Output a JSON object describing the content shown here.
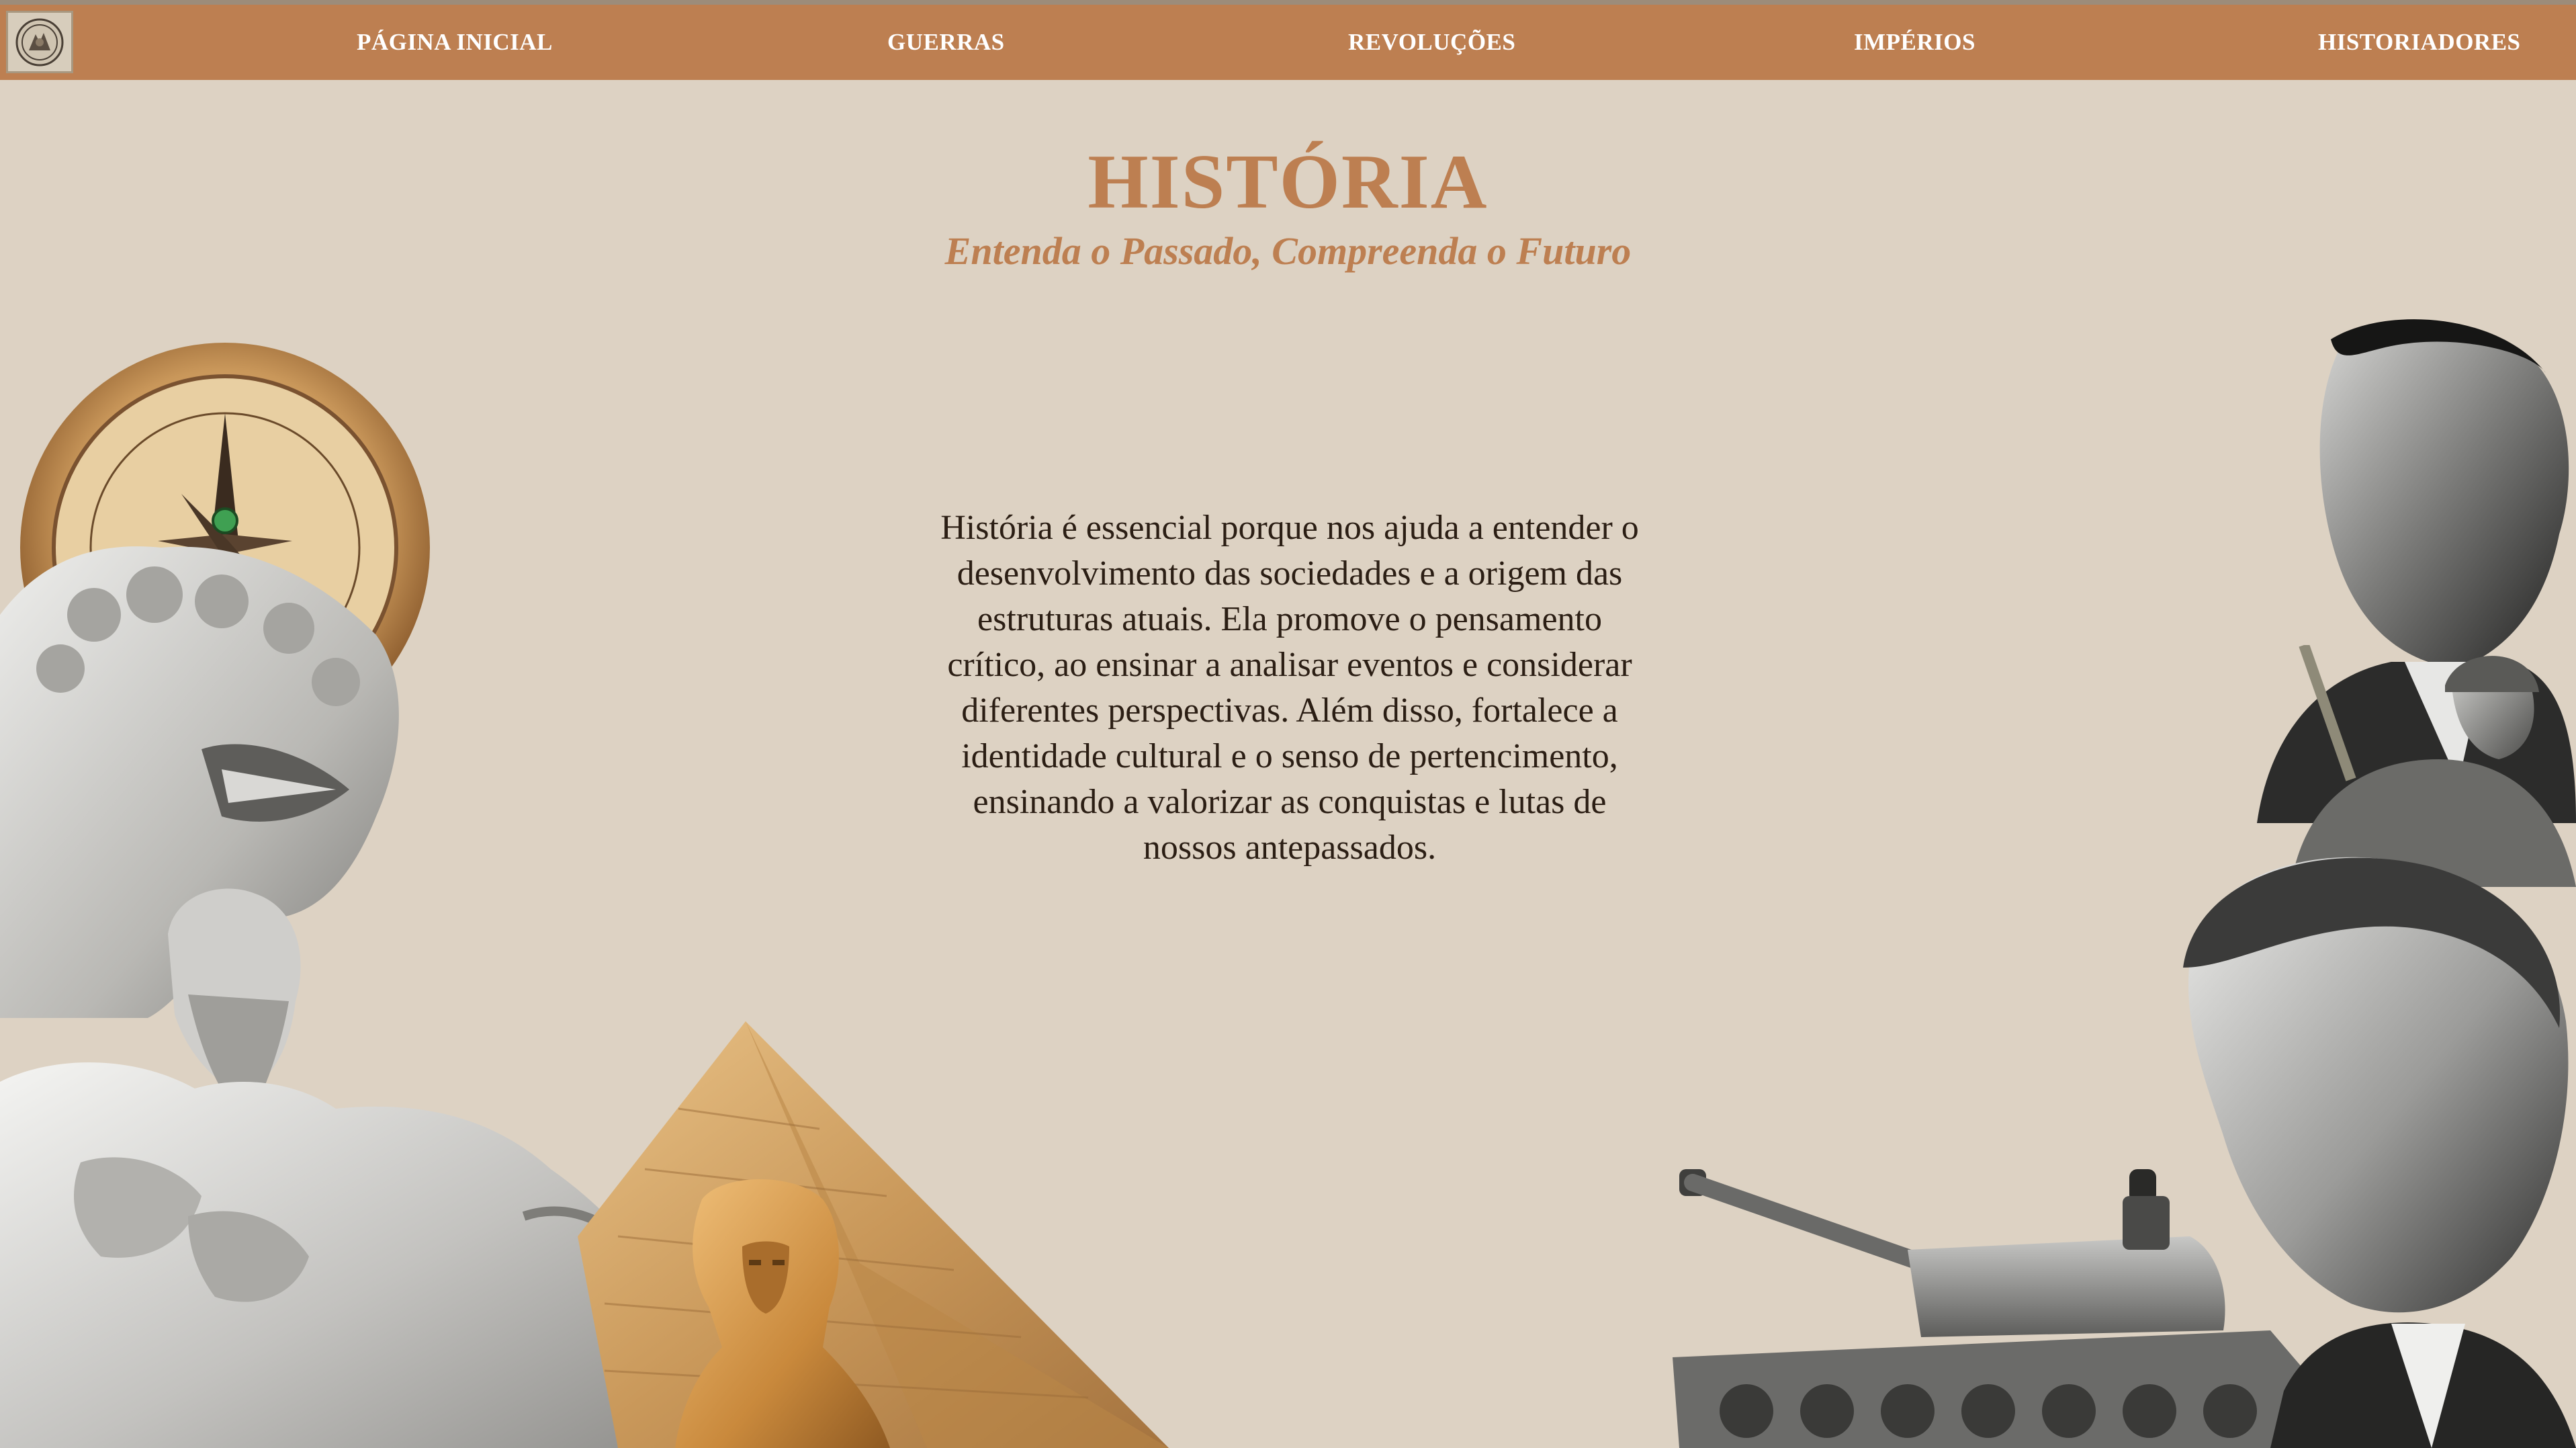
{
  "nav": {
    "items": [
      {
        "label": "PÁGINA INICIAL"
      },
      {
        "label": "GUERRAS"
      },
      {
        "label": "REVOLUÇÕES"
      },
      {
        "label": "IMPÉRIOS"
      },
      {
        "label": "HISTORIADORES"
      }
    ]
  },
  "hero": {
    "title": "HISTÓRIA",
    "subtitle": "Entenda o Passado, Compreenda o Futuro"
  },
  "intro": {
    "text": "História é essencial porque nos ajuda a entender o desenvolvimento das sociedades e a origem das estruturas atuais. Ela promove o pensamento crítico, ao ensinar a analisar eventos e considerar diferentes perspectivas. Além disso, fortalece a identidade cultural e o senso de pertencimento, ensinando a valorizar as conquistas e lutas de nossos antepassados."
  },
  "theme": {
    "nav_bg": "#bd7f51",
    "page_bg": "#ddd2c3",
    "accent": "#bd7f51",
    "text": "#2b1e14"
  },
  "images": {
    "logo": "emblem-icon",
    "left_collage": [
      "compass-image",
      "lion-statue-image",
      "zeus-statue-image"
    ],
    "center_collage": [
      "pyramid-image",
      "sphinx-image"
    ],
    "right_collage": [
      "tank-image",
      "portrait-image",
      "soldier-image",
      "portrait-image"
    ]
  }
}
